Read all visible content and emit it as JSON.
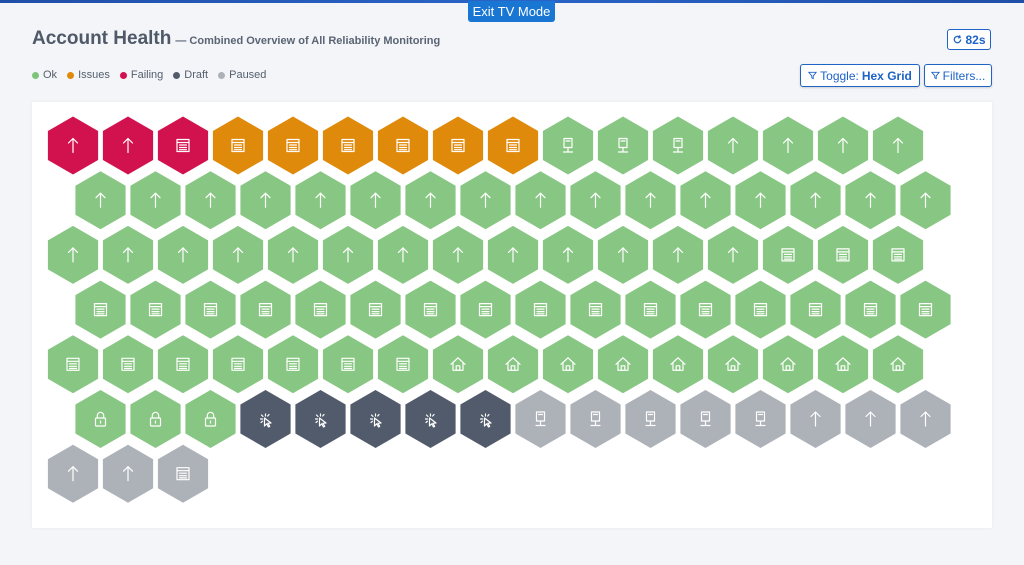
{
  "header": {
    "exit_label": "Exit TV Mode",
    "title": "Account Health",
    "subtitle": "— Combined Overview of All Reliability Monitoring",
    "refresh_label": "82s",
    "refresh_icon": "refresh-icon"
  },
  "legend": [
    {
      "label": "Ok",
      "color": "#7dc47a"
    },
    {
      "label": "Issues",
      "color": "#e08a0b"
    },
    {
      "label": "Failing",
      "color": "#d2124f"
    },
    {
      "label": "Draft",
      "color": "#525b6b"
    },
    {
      "label": "Paused",
      "color": "#adb1b8"
    }
  ],
  "toolbar": {
    "toggle_prefix": "Toggle:",
    "toggle_value": "Hex Grid",
    "filters_label": "Filters...",
    "filter_icon": "filter-icon"
  },
  "colors": {
    "ok": "#88c783",
    "issues": "#e08a0b",
    "failing": "#d2124f",
    "draft": "#525b6b",
    "paused": "#adb1b8"
  },
  "grid": {
    "rows": [
      [
        [
          "failing",
          "arrow"
        ],
        [
          "failing",
          "arrow"
        ],
        [
          "failing",
          "doc"
        ],
        [
          "issues",
          "doc"
        ],
        [
          "issues",
          "doc"
        ],
        [
          "issues",
          "doc"
        ],
        [
          "issues",
          "doc"
        ],
        [
          "issues",
          "doc"
        ],
        [
          "issues",
          "doc"
        ],
        [
          "ok",
          "device"
        ],
        [
          "ok",
          "device"
        ],
        [
          "ok",
          "device"
        ],
        [
          "ok",
          "arrow"
        ],
        [
          "ok",
          "arrow"
        ],
        [
          "ok",
          "arrow"
        ],
        [
          "ok",
          "arrow"
        ]
      ],
      [
        [
          "ok",
          "arrow"
        ],
        [
          "ok",
          "arrow"
        ],
        [
          "ok",
          "arrow"
        ],
        [
          "ok",
          "arrow"
        ],
        [
          "ok",
          "arrow"
        ],
        [
          "ok",
          "arrow"
        ],
        [
          "ok",
          "arrow"
        ],
        [
          "ok",
          "arrow"
        ],
        [
          "ok",
          "arrow"
        ],
        [
          "ok",
          "arrow"
        ],
        [
          "ok",
          "arrow"
        ],
        [
          "ok",
          "arrow"
        ],
        [
          "ok",
          "arrow"
        ],
        [
          "ok",
          "arrow"
        ],
        [
          "ok",
          "arrow"
        ],
        [
          "ok",
          "arrow"
        ]
      ],
      [
        [
          "ok",
          "arrow"
        ],
        [
          "ok",
          "arrow"
        ],
        [
          "ok",
          "arrow"
        ],
        [
          "ok",
          "arrow"
        ],
        [
          "ok",
          "arrow"
        ],
        [
          "ok",
          "arrow"
        ],
        [
          "ok",
          "arrow"
        ],
        [
          "ok",
          "arrow"
        ],
        [
          "ok",
          "arrow"
        ],
        [
          "ok",
          "arrow"
        ],
        [
          "ok",
          "arrow"
        ],
        [
          "ok",
          "arrow"
        ],
        [
          "ok",
          "arrow"
        ],
        [
          "ok",
          "doc"
        ],
        [
          "ok",
          "doc"
        ],
        [
          "ok",
          "doc"
        ]
      ],
      [
        [
          "ok",
          "doc"
        ],
        [
          "ok",
          "doc"
        ],
        [
          "ok",
          "doc"
        ],
        [
          "ok",
          "doc"
        ],
        [
          "ok",
          "doc"
        ],
        [
          "ok",
          "doc"
        ],
        [
          "ok",
          "doc"
        ],
        [
          "ok",
          "doc"
        ],
        [
          "ok",
          "doc"
        ],
        [
          "ok",
          "doc"
        ],
        [
          "ok",
          "doc"
        ],
        [
          "ok",
          "doc"
        ],
        [
          "ok",
          "doc"
        ],
        [
          "ok",
          "doc"
        ],
        [
          "ok",
          "doc"
        ],
        [
          "ok",
          "doc"
        ]
      ],
      [
        [
          "ok",
          "doc"
        ],
        [
          "ok",
          "doc"
        ],
        [
          "ok",
          "doc"
        ],
        [
          "ok",
          "doc"
        ],
        [
          "ok",
          "doc"
        ],
        [
          "ok",
          "doc"
        ],
        [
          "ok",
          "doc"
        ],
        [
          "ok",
          "home"
        ],
        [
          "ok",
          "home"
        ],
        [
          "ok",
          "home"
        ],
        [
          "ok",
          "home"
        ],
        [
          "ok",
          "home"
        ],
        [
          "ok",
          "home"
        ],
        [
          "ok",
          "home"
        ],
        [
          "ok",
          "home"
        ],
        [
          "ok",
          "home"
        ]
      ],
      [
        [
          "ok",
          "lock"
        ],
        [
          "ok",
          "lock"
        ],
        [
          "ok",
          "lock"
        ],
        [
          "draft",
          "cursor"
        ],
        [
          "draft",
          "cursor"
        ],
        [
          "draft",
          "cursor"
        ],
        [
          "draft",
          "cursor"
        ],
        [
          "draft",
          "cursor"
        ],
        [
          "paused",
          "device"
        ],
        [
          "paused",
          "device"
        ],
        [
          "paused",
          "device"
        ],
        [
          "paused",
          "device"
        ],
        [
          "paused",
          "device"
        ],
        [
          "paused",
          "arrow"
        ],
        [
          "paused",
          "arrow"
        ],
        [
          "paused",
          "arrow"
        ]
      ],
      [
        [
          "paused",
          "arrow"
        ],
        [
          "paused",
          "arrow"
        ],
        [
          "paused",
          "doc"
        ]
      ]
    ]
  }
}
